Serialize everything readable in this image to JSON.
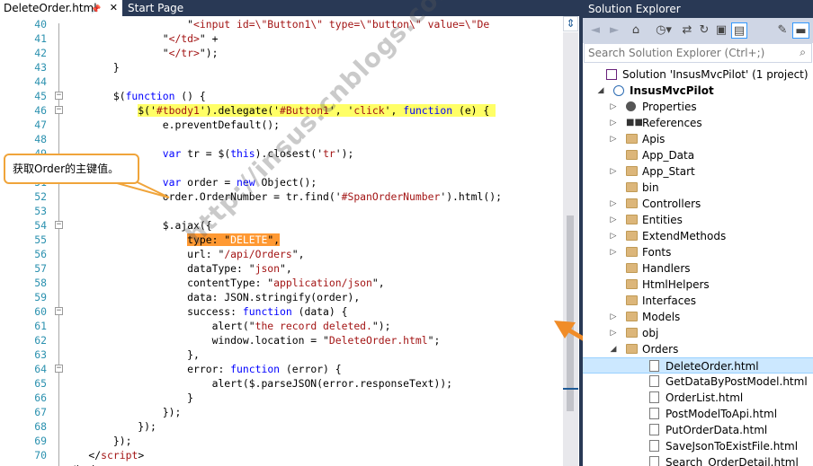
{
  "editor": {
    "tabs": [
      {
        "label": "DeleteOrder.html",
        "active": true
      },
      {
        "label": "Start Page",
        "active": false
      }
    ],
    "lines": [
      {
        "num": "40",
        "fold": "",
        "html": "                    \"<span class='st'>&lt;input id=\\\"Button1\\\" type=\\\"button\\\" value=\\\"De</span>"
      },
      {
        "num": "41",
        "fold": "",
        "html": "                \"<span class='st'>&lt;/td&gt;</span>\" +"
      },
      {
        "num": "42",
        "fold": "",
        "html": "                \"<span class='st'>&lt;/tr&gt;</span>\");"
      },
      {
        "num": "43",
        "fold": "",
        "html": "        }"
      },
      {
        "num": "44",
        "fold": "",
        "html": ""
      },
      {
        "num": "45",
        "fold": "−",
        "html": "        $(<span class='kw'>function</span> () {"
      },
      {
        "num": "46",
        "fold": "−",
        "html": "            <span class='hl-yellow'>$('<span class='st'>#tbody1</span>').delegate('<span class='st'>#Button1</span>', '<span class='st'>click</span>', <span class='kw'>function</span> (e) { </span>"
      },
      {
        "num": "47",
        "fold": "",
        "html": "                e.preventDefault();"
      },
      {
        "num": "48",
        "fold": "",
        "html": ""
      },
      {
        "num": "49",
        "fold": "",
        "html": "                <span class='kw'>var</span> tr = $(<span class='kw'>this</span>).closest('<span class='st'>tr</span>');"
      },
      {
        "num": "50",
        "fold": "",
        "html": ""
      },
      {
        "num": "51",
        "fold": "",
        "html": "                <span class='kw'>var</span> order = <span class='kw'>new</span> Object();"
      },
      {
        "num": "52",
        "fold": "",
        "html": "                order.OrderNumber = tr.find('<span class='st'>#SpanOrderNumber</span>').html();"
      },
      {
        "num": "53",
        "fold": "",
        "html": ""
      },
      {
        "num": "54",
        "fold": "−",
        "html": "                $.ajax({"
      },
      {
        "num": "55",
        "fold": "",
        "html": "                    <span class='hl-orange'>type: \"<span class='st' style='color:#fff'>DELETE</span>\",</span>"
      },
      {
        "num": "56",
        "fold": "",
        "html": "                    url: \"<span class='st'>/api/Orders</span>\","
      },
      {
        "num": "57",
        "fold": "",
        "html": "                    dataType: \"<span class='st'>json</span>\","
      },
      {
        "num": "58",
        "fold": "",
        "html": "                    contentType: \"<span class='st'>application/json</span>\","
      },
      {
        "num": "59",
        "fold": "",
        "html": "                    data: JSON.stringify(order),"
      },
      {
        "num": "60",
        "fold": "−",
        "html": "                    success: <span class='kw'>function</span> (data) {"
      },
      {
        "num": "61",
        "fold": "",
        "html": "                        alert(\"<span class='st'>the record deleted.</span>\");"
      },
      {
        "num": "62",
        "fold": "",
        "html": "                        window.location = \"<span class='st'>DeleteOrder.html</span>\";"
      },
      {
        "num": "63",
        "fold": "",
        "html": "                    },"
      },
      {
        "num": "64",
        "fold": "−",
        "html": "                    error: <span class='kw'>function</span> (error) {"
      },
      {
        "num": "65",
        "fold": "",
        "html": "                        alert($.parseJSON(error.responseText));"
      },
      {
        "num": "66",
        "fold": "",
        "html": "                    }"
      },
      {
        "num": "67",
        "fold": "",
        "html": "                });"
      },
      {
        "num": "68",
        "fold": "",
        "html": "            });"
      },
      {
        "num": "69",
        "fold": "",
        "html": "        });"
      },
      {
        "num": "70",
        "fold": "",
        "html": "    &lt;/<span class='st'>script</span>&gt;"
      },
      {
        "num": "",
        "fold": "",
        "html": "&lt;/body&gt;"
      }
    ]
  },
  "callout": {
    "text": "获取Order的主键值。"
  },
  "watermark": {
    "text": "http://insus.cnblogs.com"
  },
  "solution_explorer": {
    "title": "Solution Explorer",
    "search_placeholder": "Search Solution Explorer (Ctrl+;)",
    "items": [
      {
        "label": "Solution 'InsusMvcPilot' (1 project)",
        "indent": 0,
        "icon": "sln",
        "expander": "",
        "bold": false,
        "selected": false
      },
      {
        "label": "InsusMvcPilot",
        "indent": 1,
        "icon": "proj",
        "expander": "◢",
        "bold": true,
        "selected": false
      },
      {
        "label": "Properties",
        "indent": 2,
        "icon": "props",
        "expander": "▷",
        "bold": false,
        "selected": false
      },
      {
        "label": "References",
        "indent": 2,
        "icon": "refs",
        "expander": "▷",
        "bold": false,
        "selected": false
      },
      {
        "label": "Apis",
        "indent": 2,
        "icon": "folder",
        "expander": "▷",
        "bold": false,
        "selected": false
      },
      {
        "label": "App_Data",
        "indent": 2,
        "icon": "folder",
        "expander": "",
        "bold": false,
        "selected": false
      },
      {
        "label": "App_Start",
        "indent": 2,
        "icon": "folder",
        "expander": "▷",
        "bold": false,
        "selected": false
      },
      {
        "label": "bin",
        "indent": 2,
        "icon": "folder",
        "expander": "",
        "bold": false,
        "selected": false
      },
      {
        "label": "Controllers",
        "indent": 2,
        "icon": "folder",
        "expander": "▷",
        "bold": false,
        "selected": false
      },
      {
        "label": "Entities",
        "indent": 2,
        "icon": "folder",
        "expander": "▷",
        "bold": false,
        "selected": false
      },
      {
        "label": "ExtendMethods",
        "indent": 2,
        "icon": "folder",
        "expander": "▷",
        "bold": false,
        "selected": false
      },
      {
        "label": "Fonts",
        "indent": 2,
        "icon": "folder",
        "expander": "▷",
        "bold": false,
        "selected": false
      },
      {
        "label": "Handlers",
        "indent": 2,
        "icon": "folder",
        "expander": "",
        "bold": false,
        "selected": false
      },
      {
        "label": "HtmlHelpers",
        "indent": 2,
        "icon": "folder",
        "expander": "",
        "bold": false,
        "selected": false
      },
      {
        "label": "Interfaces",
        "indent": 2,
        "icon": "folder",
        "expander": "",
        "bold": false,
        "selected": false
      },
      {
        "label": "Models",
        "indent": 2,
        "icon": "folder",
        "expander": "▷",
        "bold": false,
        "selected": false
      },
      {
        "label": "obj",
        "indent": 2,
        "icon": "folder",
        "expander": "▷",
        "bold": false,
        "selected": false
      },
      {
        "label": "Orders",
        "indent": 2,
        "icon": "folder",
        "expander": "◢",
        "bold": false,
        "selected": false
      },
      {
        "label": "DeleteOrder.html",
        "indent": 3,
        "icon": "file",
        "expander": "",
        "bold": false,
        "selected": true
      },
      {
        "label": "GetDataByPostModel.html",
        "indent": 3,
        "icon": "file",
        "expander": "",
        "bold": false,
        "selected": false
      },
      {
        "label": "OrderList.html",
        "indent": 3,
        "icon": "file",
        "expander": "",
        "bold": false,
        "selected": false
      },
      {
        "label": "PostModelToApi.html",
        "indent": 3,
        "icon": "file",
        "expander": "",
        "bold": false,
        "selected": false
      },
      {
        "label": "PutOrderData.html",
        "indent": 3,
        "icon": "file",
        "expander": "",
        "bold": false,
        "selected": false
      },
      {
        "label": "SaveJsonToExistFile.html",
        "indent": 3,
        "icon": "file",
        "expander": "",
        "bold": false,
        "selected": false
      },
      {
        "label": "Search_OrderDetail.html",
        "indent": 3,
        "icon": "file",
        "expander": "",
        "bold": false,
        "selected": false
      }
    ]
  },
  "colors": {
    "chrome": "#293955",
    "highlight_yellow": "#ffff66",
    "highlight_orange": "#ff9933",
    "callout_border": "#f0a43a",
    "arrow": "#f08c28",
    "keyword": "#0000ff",
    "string": "#a31515",
    "line_number": "#2b91af",
    "selection": "#cce8ff"
  }
}
